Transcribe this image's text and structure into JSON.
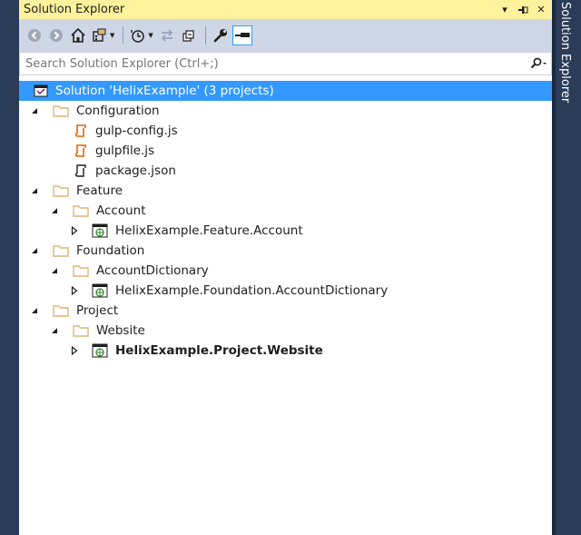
{
  "panel": {
    "title": "Solution Explorer",
    "pin_glyph": "⊣",
    "dropdown_glyph": "▾",
    "close_glyph": "✕"
  },
  "search": {
    "placeholder": "Search Solution Explorer (Ctrl+;)"
  },
  "tree": {
    "solution": "Solution 'HelixExample' (3 projects)",
    "configuration": {
      "label": "Configuration",
      "files": [
        "gulp-config.js",
        "gulpfile.js",
        "package.json"
      ]
    },
    "feature": {
      "label": "Feature",
      "sub": "Account",
      "project": "HelixExample.Feature.Account"
    },
    "foundation": {
      "label": "Foundation",
      "sub": "AccountDictionary",
      "project": "HelixExample.Foundation.AccountDictionary"
    },
    "project": {
      "label": "Project",
      "sub": "Website",
      "project": "HelixExample.Project.Website"
    }
  },
  "side_tab": {
    "label": "Solution Explorer"
  },
  "colors": {
    "title_bar": "#fff29d",
    "toolbar": "#cfd6e5",
    "selection": "#3399ff",
    "frame": "#293955",
    "folder": "#dcb67a",
    "js_icon": "#e36209"
  }
}
